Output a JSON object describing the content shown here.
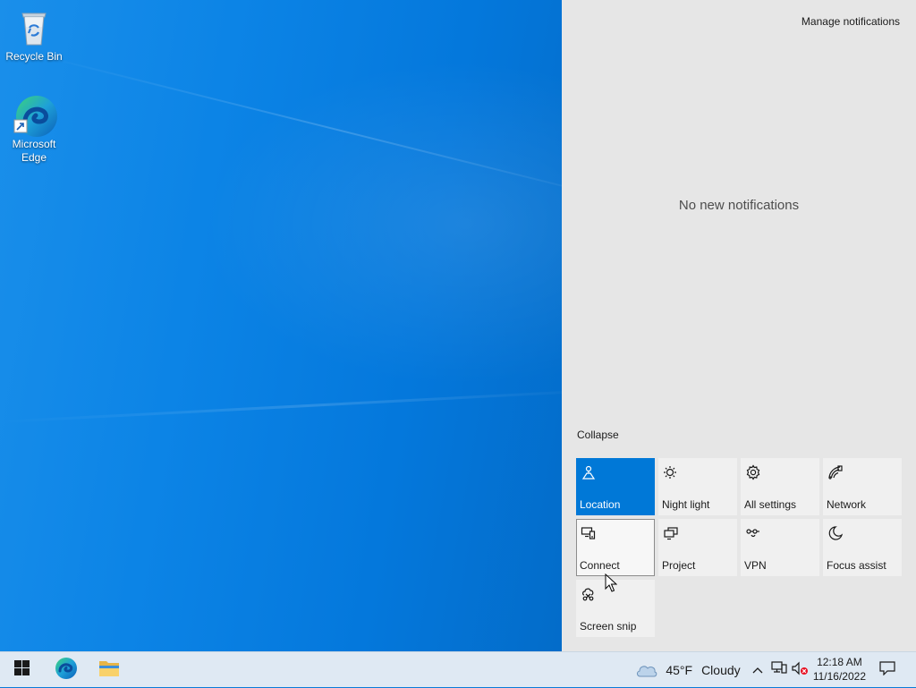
{
  "desktop": {
    "icons": [
      {
        "label": "Recycle Bin",
        "icon": "recycle-bin-icon"
      },
      {
        "label": "Microsoft Edge",
        "icon": "edge-icon"
      }
    ]
  },
  "action_center": {
    "manage_label": "Manage notifications",
    "empty_message": "No new notifications",
    "collapse_label": "Collapse",
    "quick_actions": [
      {
        "label": "Location",
        "icon": "location-icon",
        "state": "on"
      },
      {
        "label": "Night light",
        "icon": "night-light-icon",
        "state": "off"
      },
      {
        "label": "All settings",
        "icon": "settings-gear-icon",
        "state": "off"
      },
      {
        "label": "Network",
        "icon": "network-icon",
        "state": "off"
      },
      {
        "label": "Connect",
        "icon": "connect-icon",
        "state": "hover"
      },
      {
        "label": "Project",
        "icon": "project-icon",
        "state": "off"
      },
      {
        "label": "VPN",
        "icon": "vpn-icon",
        "state": "off"
      },
      {
        "label": "Focus assist",
        "icon": "moon-icon",
        "state": "off"
      },
      {
        "label": "Screen snip",
        "icon": "screen-snip-icon",
        "state": "off"
      }
    ],
    "accent_color": "#0078d7"
  },
  "taskbar": {
    "pinned": [
      {
        "name": "Start",
        "icon": "windows-start-icon"
      },
      {
        "name": "Microsoft Edge",
        "icon": "edge-icon"
      },
      {
        "name": "File Explorer",
        "icon": "folder-icon"
      }
    ],
    "weather": {
      "temp": "45°F",
      "condition": "Cloudy",
      "icon": "cloud-icon"
    },
    "tray_icons": [
      "chevron-up-icon",
      "network-wired-icon",
      "volume-muted-icon"
    ],
    "clock": {
      "time": "12:18 AM",
      "date": "11/16/2022"
    },
    "notification_icon": "action-center-icon"
  }
}
